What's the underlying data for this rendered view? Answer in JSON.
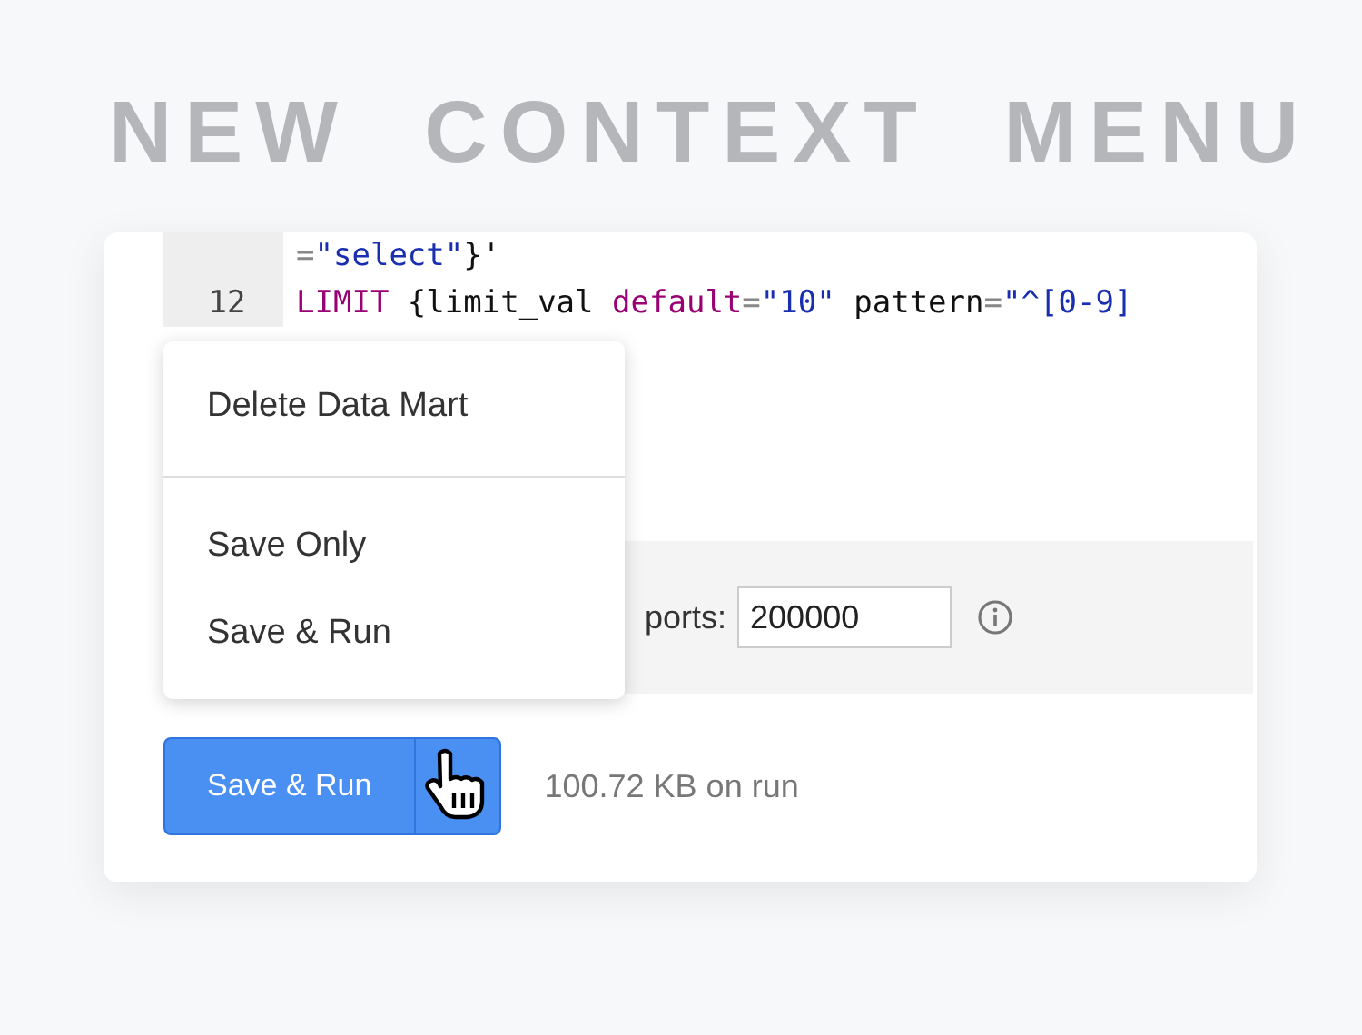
{
  "heading": "NEW  CONTEXT  MENU",
  "code_lines": [
    {
      "tokens": [
        {
          "kind": "op",
          "text": "="
        },
        {
          "kind": "string",
          "text": "\"select\""
        },
        {
          "kind": "plain",
          "text": "}'"
        }
      ]
    },
    {
      "number": "12",
      "tokens": [
        {
          "kind": "keyword",
          "text": "LIMIT"
        },
        {
          "kind": "plain",
          "text": " {limit_val "
        },
        {
          "kind": "keyword",
          "text": "default"
        },
        {
          "kind": "op",
          "text": "="
        },
        {
          "kind": "string",
          "text": "\"10\""
        },
        {
          "kind": "plain",
          "text": " pattern"
        },
        {
          "kind": "op",
          "text": "="
        },
        {
          "kind": "string",
          "text": "\"^[0-9]"
        }
      ]
    }
  ],
  "settings_row": {
    "label": "ports:",
    "value": "200000"
  },
  "context_menu": {
    "sections": [
      [
        "Delete Data Mart"
      ],
      [
        "Save Only",
        "Save & Run"
      ]
    ]
  },
  "save_button": {
    "label": "Save & Run"
  },
  "run_size": "100.72 KB on run"
}
